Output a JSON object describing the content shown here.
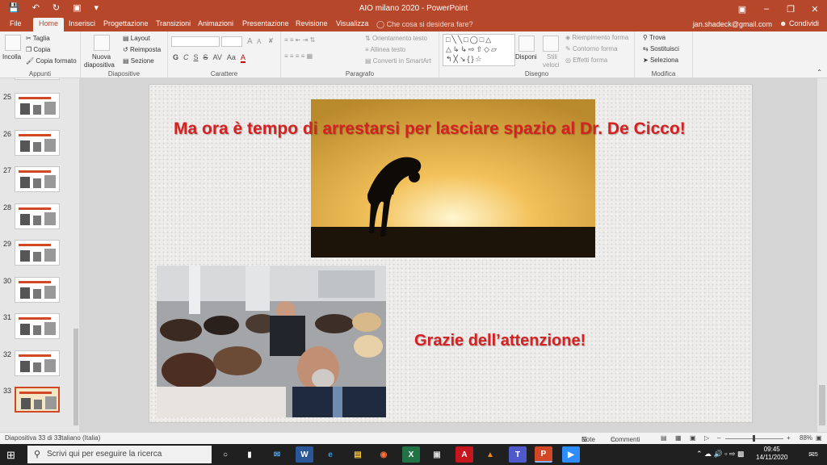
{
  "window": {
    "title": "AIO milano 2020 - PowerPoint",
    "min_icon": "minimize-icon",
    "restore_icon": "restore-icon",
    "close_icon": "close-icon"
  },
  "tabs": {
    "file": "File",
    "items": [
      "Home",
      "Inserisci",
      "Progettazione",
      "Transizioni",
      "Animazioni",
      "Presentazione",
      "Revisione",
      "Visualizza"
    ],
    "search": "Che cosa si desidera fare?",
    "account": "jan.shadeck@gmail.com",
    "share": "Condividi"
  },
  "ribbon": {
    "clipboard": {
      "paste": "Incolla",
      "cut": "Taglia",
      "copy": "Copia",
      "format_painter": "Copia formato",
      "label": "Appunti"
    },
    "slides": {
      "new_slide_line1": "Nuova",
      "new_slide_line2": "diapositiva",
      "layout": "Layout",
      "reset": "Reimposta",
      "section": "Sezione",
      "label": "Diapositive"
    },
    "font": {
      "bold": "G",
      "italic": "C",
      "underline": "S",
      "strike": "S",
      "spacing": "AV",
      "case": "Aa",
      "grow": "A",
      "shrink": "A",
      "label": "Carattere"
    },
    "paragraph": {
      "text_direction": "Orientamento testo",
      "align_text": "Allinea testo",
      "smartart": "Converti in SmartArt",
      "label": "Paragrafo"
    },
    "drawing": {
      "arrange": "Disponi",
      "quick_styles_line1": "Stili",
      "quick_styles_line2": "veloci",
      "fill": "Riempimento forma",
      "outline": "Contorno forma",
      "effects": "Effetti forma",
      "label": "Disegno"
    },
    "editing": {
      "find": "Trova",
      "replace": "Sostituisci",
      "select": "Seleziona",
      "label": "Modifica"
    }
  },
  "thumbnails": [
    {
      "num": "25"
    },
    {
      "num": "26"
    },
    {
      "num": "27"
    },
    {
      "num": "28"
    },
    {
      "num": "29"
    },
    {
      "num": "30"
    },
    {
      "num": "31"
    },
    {
      "num": "32"
    },
    {
      "num": "33"
    }
  ],
  "slide": {
    "title": "Ma ora è tempo di arrestarsi per lasciare spazio al Dr. De Cicco!",
    "subtitle": "Grazie dell’attenzione!"
  },
  "status": {
    "slide_info": "Diapositiva 33 di 33",
    "language": "Italiano (Italia)",
    "notes": "Note",
    "comments": "Commenti",
    "zoom": "88%"
  },
  "taskbar": {
    "search_placeholder": "Scrivi qui per eseguire la ricerca",
    "time": "09:45",
    "date": "14/11/2020",
    "notification_count": "5"
  },
  "colors": {
    "accent": "#b7472a",
    "slide_title": "#d42121"
  }
}
